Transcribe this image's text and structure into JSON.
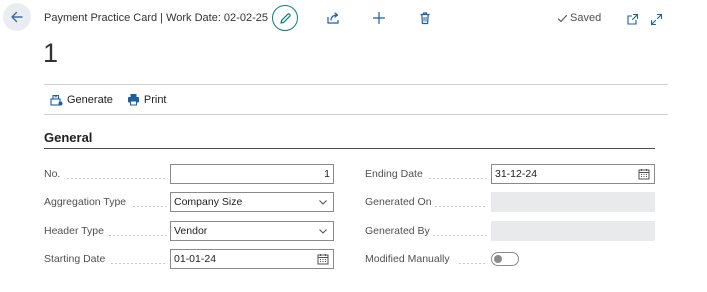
{
  "header": {
    "caption": "Payment Practice Card | Work Date: 02-02-25",
    "saved_label": "Saved",
    "record_title": "1"
  },
  "actions": [
    {
      "label": "Generate",
      "icon": "generate-icon"
    },
    {
      "label": "Print",
      "icon": "printer-icon"
    }
  ],
  "general": {
    "title": "General",
    "left_fields": [
      {
        "label": "No.",
        "value": "1",
        "type": "text-right"
      },
      {
        "label": "Aggregation Type",
        "value": "Company Size",
        "type": "select"
      },
      {
        "label": "Header Type",
        "value": "Vendor",
        "type": "select"
      },
      {
        "label": "Starting Date",
        "value": "01-01-24",
        "type": "date"
      }
    ],
    "right_fields": [
      {
        "label": "Ending Date",
        "value": "31-12-24",
        "type": "date"
      },
      {
        "label": "Generated On",
        "value": "",
        "type": "readonly"
      },
      {
        "label": "Generated By",
        "value": "",
        "type": "readonly"
      },
      {
        "label": "Modified Manually",
        "value": "off",
        "type": "toggle"
      }
    ]
  },
  "colors": {
    "accent": "#0b7f7a",
    "action_icon": "#1d5fa0",
    "readonly_bg": "#e8eaec"
  }
}
